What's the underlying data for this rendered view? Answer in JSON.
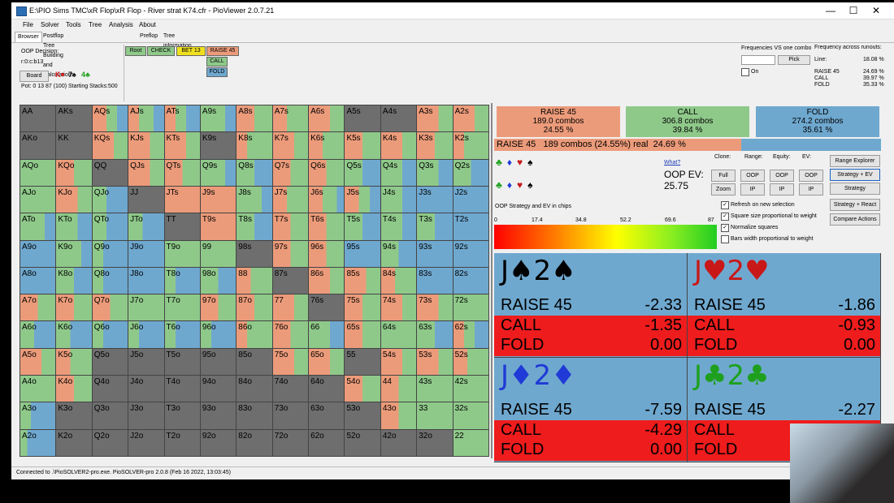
{
  "window": {
    "title": "E:\\PIO Sims TMC\\xR Flop\\xR Flop - River strat K74.cfr - PioViewer 2.0.7.21",
    "minimize": "—",
    "maximize": "☐",
    "close": "✕"
  },
  "menu": [
    "File",
    "Solver",
    "Tools",
    "Tree",
    "Analysis",
    "About"
  ],
  "tabs": [
    "Browser",
    "Postflop Tree Building and Calculations",
    "Preflop",
    "Tree information"
  ],
  "left_info": {
    "decision_label": "OOP Decision:",
    "decision_value": "r:0:c:b13",
    "board_button": "Board",
    "board_cards": [
      {
        "text": "K♥",
        "color": "#e02020"
      },
      {
        "text": "7♠",
        "color": "#000000"
      },
      {
        "text": "4♣",
        "color": "#1ea01e"
      }
    ],
    "pot_line": "Pot: 0 13 87 (100) Starting Stacks:500"
  },
  "nav": {
    "root": "Root",
    "check": "CHECK",
    "bet": "BET 13",
    "raise": "RAISE 45",
    "call": "CALL",
    "fold": "FOLD"
  },
  "freq_panel": {
    "freq_vs_combo": "Frequencies VS one combo",
    "pick_button": "Pick",
    "on_label": "On",
    "across_label": "Frequency across runouts:",
    "line_label": "Line:",
    "line_value": "18.08 %",
    "rows": [
      {
        "name": "RAISE 45",
        "value": "24.69 %"
      },
      {
        "name": "CALL",
        "value": "39.97 %"
      },
      {
        "name": "FOLD",
        "value": "35.33 %"
      }
    ]
  },
  "action_boxes": [
    {
      "title": "RAISE 45",
      "combos": "189.0 combos",
      "pct": "24.55 %",
      "color": "#ec9b7a"
    },
    {
      "title": "CALL",
      "combos": "306.8 combos",
      "pct": "39.84 %",
      "color": "#8fc98a"
    },
    {
      "title": "FOLD",
      "combos": "274.2 combos",
      "pct": "35.61 %",
      "color": "#6fa8cf"
    }
  ],
  "selected_line": "RAISE 45   189 combos (24.55%) real  24.69 %",
  "controls": {
    "what_link": "What?",
    "ev_label": "OOP EV:",
    "ev_value": "25.75",
    "clone": "Clone:",
    "range": "Range:",
    "equity": "Equity:",
    "ev": "EV:",
    "full": "Full",
    "zoom": "Zoom",
    "oop1": "OOP",
    "ip1": "IP",
    "oop2": "OOP",
    "ip2": "IP",
    "oop3": "OOP",
    "ip3": "IP",
    "range_explorer": "Range Explorer",
    "strategy_ev": "Strategy + EV",
    "strategy": "Strategy",
    "strategy_react": "Strategy + React",
    "compare_actions": "Compare Actions",
    "strategy_caption": "OOP Strategy and EV in chips",
    "checkboxes": [
      {
        "label": "Refresh on new selection",
        "checked": true
      },
      {
        "label": "Square size proportional to weight",
        "checked": true
      },
      {
        "label": "Normalize squares",
        "checked": true
      },
      {
        "label": "Bars width proportional to weight",
        "checked": false
      }
    ]
  },
  "scale_ticks": [
    "0",
    "17.4",
    "34.8",
    "52.2",
    "69.6",
    "87"
  ],
  "suit_panels": [
    {
      "hand": [
        "J♠",
        "2♠"
      ],
      "color": "#000000",
      "raise": "-2.33",
      "call": "-1.35",
      "fold": "0.00",
      "raise_name": "RAISE 45",
      "call_name": "CALL",
      "fold_name": "FOLD"
    },
    {
      "hand": [
        "J♥",
        "2♥"
      ],
      "color": "#c81818",
      "raise": "-1.86",
      "call": "-0.93",
      "fold": "0.00",
      "raise_name": "RAISE 45",
      "call_name": "CALL",
      "fold_name": "FOLD"
    },
    {
      "hand": [
        "J♦",
        "2♦"
      ],
      "color": "#1f3ad6",
      "raise": "-7.59",
      "call": "-4.29",
      "fold": "0.00",
      "raise_name": "RAISE 45",
      "call_name": "CALL",
      "fold_name": "FOLD"
    },
    {
      "hand": [
        "J♣",
        "2♣"
      ],
      "color": "#1ea01e",
      "raise": "-2.27",
      "call": "",
      "fold": "",
      "raise_name": "RAISE 45",
      "call_name": "CALL",
      "fold_name": "FOLD"
    }
  ],
  "status": "Connected to .\\PioSOLVER2-pro.exe. PioSOLVER-pro 2.0.8 (Feb 16 2022, 13:03:45)",
  "colors": {
    "raise": "#ec9b7a",
    "call": "#8fc98a",
    "fold": "#6fa8cf",
    "none": "#6e6e6e"
  },
  "hands": [
    [
      "AA",
      "AKs",
      "AQs",
      "AJs",
      "ATs",
      "A9s",
      "A8s",
      "A7s",
      "A6s",
      "A5s",
      "A4s",
      "A3s",
      "A2s"
    ],
    [
      "AKo",
      "KK",
      "KQs",
      "KJs",
      "KTs",
      "K9s",
      "K8s",
      "K7s",
      "K6s",
      "K5s",
      "K4s",
      "K3s",
      "K2s"
    ],
    [
      "AQo",
      "KQo",
      "QQ",
      "QJs",
      "QTs",
      "Q9s",
      "Q8s",
      "Q7s",
      "Q6s",
      "Q5s",
      "Q4s",
      "Q3s",
      "Q2s"
    ],
    [
      "AJo",
      "KJo",
      "QJo",
      "JJ",
      "JTs",
      "J9s",
      "J8s",
      "J7s",
      "J6s",
      "J5s",
      "J4s",
      "J3s",
      "J2s"
    ],
    [
      "ATo",
      "KTo",
      "QTo",
      "JTo",
      "TT",
      "T9s",
      "T8s",
      "T7s",
      "T6s",
      "T5s",
      "T4s",
      "T3s",
      "T2s"
    ],
    [
      "A9o",
      "K9o",
      "Q9o",
      "J9o",
      "T9o",
      "99",
      "98s",
      "97s",
      "96s",
      "95s",
      "94s",
      "93s",
      "92s"
    ],
    [
      "A8o",
      "K8o",
      "Q8o",
      "J8o",
      "T8o",
      "98o",
      "88",
      "87s",
      "86s",
      "85s",
      "84s",
      "83s",
      "82s"
    ],
    [
      "A7o",
      "K7o",
      "Q7o",
      "J7o",
      "T7o",
      "97o",
      "87o",
      "77",
      "76s",
      "75s",
      "74s",
      "73s",
      "72s"
    ],
    [
      "A6o",
      "K6o",
      "Q6o",
      "J6o",
      "T6o",
      "96o",
      "86o",
      "76o",
      "66",
      "65s",
      "64s",
      "63s",
      "62s"
    ],
    [
      "A5o",
      "K5o",
      "Q5o",
      "J5o",
      "T5o",
      "95o",
      "85o",
      "75o",
      "65o",
      "55",
      "54s",
      "53s",
      "52s"
    ],
    [
      "A4o",
      "K4o",
      "Q4o",
      "J4o",
      "T4o",
      "94o",
      "84o",
      "74o",
      "64o",
      "54o",
      "44",
      "43s",
      "42s"
    ],
    [
      "A3o",
      "K3o",
      "Q3o",
      "J3o",
      "T3o",
      "93o",
      "83o",
      "73o",
      "63o",
      "53o",
      "43o",
      "33",
      "32s"
    ],
    [
      "A2o",
      "K2o",
      "Q2o",
      "J2o",
      "T2o",
      "92o",
      "82o",
      "72o",
      "62o",
      "52o",
      "42o",
      "32o",
      "22"
    ]
  ],
  "strategy_grid": [
    [
      [
        0,
        0,
        0
      ],
      [
        0,
        0,
        0
      ],
      [
        0.4,
        0.3,
        0.3
      ],
      [
        0.3,
        0.4,
        0.3
      ],
      [
        0.3,
        0.3,
        0.4
      ],
      [
        0,
        0.7,
        0.3
      ],
      [
        0.5,
        0.5,
        0
      ],
      [
        0.4,
        0.6,
        0
      ],
      [
        0.6,
        0.4,
        0
      ],
      [
        0,
        0,
        0
      ],
      [
        0,
        0,
        0
      ],
      [
        0.6,
        0.4,
        0
      ],
      [
        0.6,
        0.4,
        0
      ]
    ],
    [
      [
        0,
        0,
        0
      ],
      [
        0,
        0,
        0
      ],
      [
        0.6,
        0.4,
        0
      ],
      [
        0.6,
        0.4,
        0
      ],
      [
        0.6,
        0.4,
        0
      ],
      [
        0,
        0,
        0
      ],
      [
        0.3,
        0.7,
        0
      ],
      [
        0.6,
        0.4,
        0
      ],
      [
        0.4,
        0.6,
        0
      ],
      [
        0.5,
        0.5,
        0
      ],
      [
        0.6,
        0.4,
        0
      ],
      [
        0.5,
        0.5,
        0
      ],
      [
        0.3,
        0.7,
        0
      ]
    ],
    [
      [
        0,
        1,
        0
      ],
      [
        0.5,
        0.5,
        0
      ],
      [
        0,
        0,
        0
      ],
      [
        0.6,
        0.4,
        0
      ],
      [
        0.5,
        0.5,
        0
      ],
      [
        0,
        0.7,
        0.3
      ],
      [
        0,
        0.5,
        0.5
      ],
      [
        0.5,
        0.5,
        0
      ],
      [
        0.5,
        0.5,
        0
      ],
      [
        0,
        0.5,
        0.5
      ],
      [
        0,
        0.6,
        0.4
      ],
      [
        0,
        0.6,
        0.4
      ],
      [
        0,
        0.5,
        0.5
      ]
    ],
    [
      [
        0,
        1,
        0
      ],
      [
        0.6,
        0.4,
        0
      ],
      [
        0,
        0.4,
        0.6
      ],
      [
        0,
        0,
        0
      ],
      [
        0.5,
        0,
        0
      ],
      [
        0.4,
        0,
        0
      ],
      [
        0,
        0.7,
        0.3
      ],
      [
        0.4,
        0.6,
        0
      ],
      [
        0.4,
        0.4,
        0.2
      ],
      [
        0.4,
        0.3,
        0.3
      ],
      [
        0,
        0.6,
        0.4
      ],
      [
        0,
        0,
        1
      ],
      [
        0,
        0,
        1
      ]
    ],
    [
      [
        0,
        0.7,
        0.3
      ],
      [
        0,
        0.6,
        0.4
      ],
      [
        0,
        0.4,
        0.6
      ],
      [
        0,
        0.4,
        0.6
      ],
      [
        0,
        0,
        0
      ],
      [
        0.5,
        0,
        0
      ],
      [
        0,
        0.5,
        0.5
      ],
      [
        0.5,
        0.5,
        0
      ],
      [
        0.5,
        0.5,
        0
      ],
      [
        0,
        0.5,
        0.5
      ],
      [
        0,
        0.6,
        0.4
      ],
      [
        0,
        0.5,
        0.5
      ],
      [
        0,
        0,
        1
      ]
    ],
    [
      [
        0,
        0,
        1
      ],
      [
        0,
        0.7,
        0.3
      ],
      [
        0,
        0.3,
        0.7
      ],
      [
        0,
        0,
        1
      ],
      [
        0,
        1,
        0
      ],
      [
        0,
        0.6,
        0
      ],
      [
        0,
        0,
        0
      ],
      [
        0.5,
        0.5,
        0
      ],
      [
        0.5,
        0.5,
        0
      ],
      [
        0,
        0,
        1
      ],
      [
        0,
        0.5,
        0.5
      ],
      [
        0,
        0,
        1
      ],
      [
        0,
        0,
        1
      ]
    ],
    [
      [
        0,
        0,
        1
      ],
      [
        0,
        0.5,
        0.5
      ],
      [
        0,
        0.3,
        0.7
      ],
      [
        0,
        0,
        1
      ],
      [
        0,
        0.3,
        0.7
      ],
      [
        0,
        0.5,
        0.5
      ],
      [
        0.4,
        0.6,
        0
      ],
      [
        0,
        0,
        0
      ],
      [
        0.6,
        0.4,
        0
      ],
      [
        0.6,
        0.4,
        0
      ],
      [
        0.4,
        0.6,
        0
      ],
      [
        0,
        0,
        1
      ],
      [
        0,
        0,
        1
      ]
    ],
    [
      [
        0.5,
        0.5,
        0
      ],
      [
        0.5,
        0.5,
        0
      ],
      [
        0.5,
        0.5,
        0
      ],
      [
        0,
        1,
        0
      ],
      [
        0,
        1,
        0
      ],
      [
        0.5,
        0.5,
        0
      ],
      [
        0.5,
        0.5,
        0
      ],
      [
        0.6,
        0.4,
        0
      ],
      [
        0,
        0,
        0
      ],
      [
        0.5,
        0.5,
        0
      ],
      [
        0.6,
        0.4,
        0
      ],
      [
        0.6,
        0.4,
        0
      ],
      [
        0,
        1,
        0
      ]
    ],
    [
      [
        0,
        0.4,
        0.6
      ],
      [
        0,
        0.4,
        0.6
      ],
      [
        0,
        0.3,
        0.7
      ],
      [
        0,
        0.3,
        0.7
      ],
      [
        0,
        0.3,
        0.7
      ],
      [
        0,
        0.3,
        0.7
      ],
      [
        0.3,
        0.7,
        0
      ],
      [
        0.5,
        0.5,
        0
      ],
      [
        0,
        0.6,
        0.4
      ],
      [
        0.5,
        0.5,
        0
      ],
      [
        0,
        1,
        0
      ],
      [
        0,
        0.5,
        0.5
      ],
      [
        0.3,
        0.3,
        0.4
      ]
    ],
    [
      [
        0.6,
        0.4,
        0
      ],
      [
        0.4,
        0.6,
        0
      ],
      [
        0,
        0,
        0
      ],
      [
        0,
        0,
        0
      ],
      [
        0,
        0,
        0
      ],
      [
        0,
        0,
        0
      ],
      [
        0,
        0,
        0
      ],
      [
        0.6,
        0.4,
        0
      ],
      [
        0.6,
        0.4,
        0
      ],
      [
        0,
        0,
        0
      ],
      [
        0.6,
        0.4,
        0
      ],
      [
        0.6,
        0.4,
        0
      ],
      [
        0.4,
        0.6,
        0
      ]
    ],
    [
      [
        0,
        1,
        0
      ],
      [
        0.5,
        0.5,
        0
      ],
      [
        0,
        0,
        0
      ],
      [
        0,
        0,
        0
      ],
      [
        0,
        0,
        0
      ],
      [
        0,
        0,
        0
      ],
      [
        0,
        0,
        0
      ],
      [
        0,
        0,
        0
      ],
      [
        0,
        0,
        0
      ],
      [
        0.5,
        0.5,
        0
      ],
      [
        0.5,
        0.5,
        0
      ],
      [
        0,
        1,
        0
      ],
      [
        0,
        1,
        0
      ]
    ],
    [
      [
        0,
        0.3,
        0.7
      ],
      [
        0,
        0,
        0
      ],
      [
        0,
        0,
        0
      ],
      [
        0,
        0,
        0
      ],
      [
        0,
        0,
        0
      ],
      [
        0,
        0,
        0
      ],
      [
        0,
        0,
        0
      ],
      [
        0,
        0,
        0
      ],
      [
        0,
        0,
        0
      ],
      [
        0,
        0,
        0
      ],
      [
        0.5,
        0.5,
        0
      ],
      [
        0,
        1,
        0
      ],
      [
        0,
        1,
        0
      ]
    ],
    [
      [
        0,
        0.2,
        0.8
      ],
      [
        0,
        0,
        0
      ],
      [
        0,
        0,
        0
      ],
      [
        0,
        0,
        0
      ],
      [
        0,
        0,
        0
      ],
      [
        0,
        0,
        0
      ],
      [
        0,
        0,
        0
      ],
      [
        0,
        0,
        0
      ],
      [
        0,
        0,
        0
      ],
      [
        0,
        0,
        0
      ],
      [
        0,
        0,
        0
      ],
      [
        0,
        0,
        0
      ],
      [
        0,
        1,
        0
      ]
    ]
  ]
}
